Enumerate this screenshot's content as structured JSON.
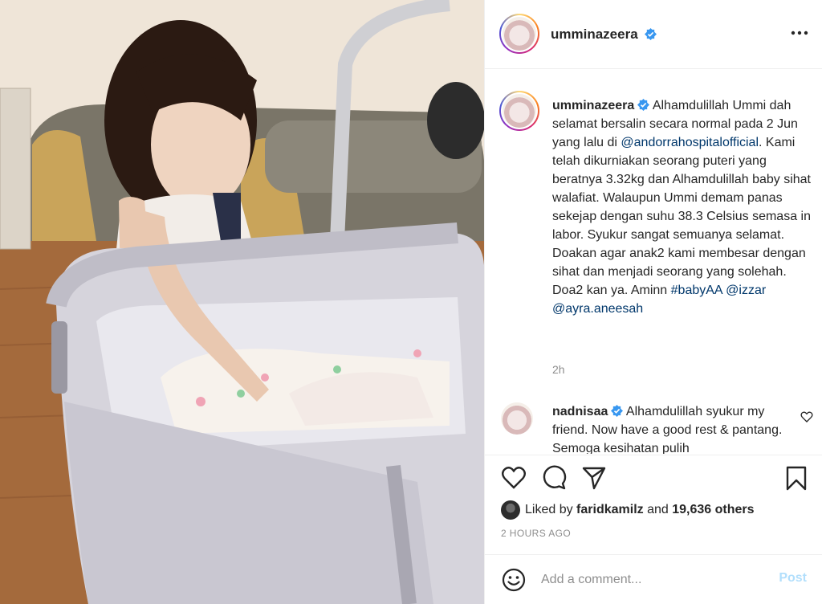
{
  "post": {
    "author": "umminazeera",
    "verified": true
  },
  "caption": {
    "author": "umminazeera",
    "text_1": "Alhamdulillah Ummi dah selamat bersalin secara normal pada 2 Jun yang lalu di",
    "mention_hospital": "@andorrahospitalofficial",
    "text_2": ". Kami telah dikurniakan seorang puteri yang beratnya 3.32kg dan Alhamdulillah baby sihat walafiat. Walaupun Ummi demam panas sekejap dengan suhu 38.3 Celsius semasa in labor. Syukur sangat semuanya selamat. Doakan agar anak2 kami membesar dengan sihat dan menjadi seorang yang solehah. Doa2 kan ya. Aminn",
    "hashtag": "#babyAA",
    "mention_1": "@izzar",
    "mention_2": "@ayra.aneesah",
    "time": "2h"
  },
  "comment": {
    "author": "nadnisaa",
    "verified": true,
    "text": "Alhamdulillah syukur my friend. Now have a good rest & pantang. Semoga kesihatan pulih"
  },
  "likes": {
    "prefix": "Liked by",
    "user": "faridkamilz",
    "joiner": "and",
    "count": "19,636 others"
  },
  "time_ago": "2 HOURS AGO",
  "add_comment": {
    "placeholder": "Add a comment...",
    "post_label": "Post"
  },
  "colors": {
    "verified_blue": "#3897f0",
    "link_blue": "#00376b",
    "muted_gray": "#8e8e8e",
    "post_disabled": "#b2dffc"
  },
  "icons": [
    "more-options-icon",
    "verified-badge-icon",
    "heart-icon",
    "comment-icon",
    "share-icon",
    "bookmark-icon",
    "emoji-icon"
  ]
}
